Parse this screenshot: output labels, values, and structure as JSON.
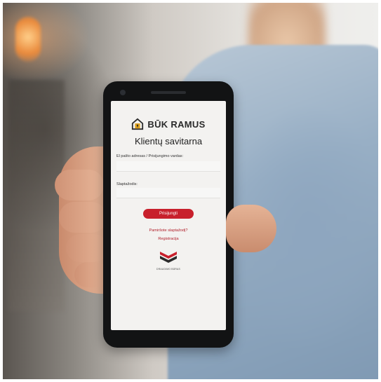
{
  "app": {
    "brand_name": "BŪK RAMUS",
    "title": "Klientų savitarna"
  },
  "form": {
    "email_label": "El pašto adresas / Prisijungimo vardas:",
    "email_value": "",
    "password_label": "Slaptažodis:",
    "password_value": "",
    "login_button": "Prisijungti",
    "forgot_password_link": "Pamiršote slaptažodį?",
    "register_link": "Registracija"
  },
  "footer": {
    "org_name": "DRAUDIMO BŪRAS"
  },
  "colors": {
    "accent": "#c8202c",
    "logo_gold": "#e0a21c",
    "text_dark": "#222222"
  },
  "icons": {
    "brand_logo": "house-icon",
    "org_logo": "chevron-stack-logo"
  }
}
